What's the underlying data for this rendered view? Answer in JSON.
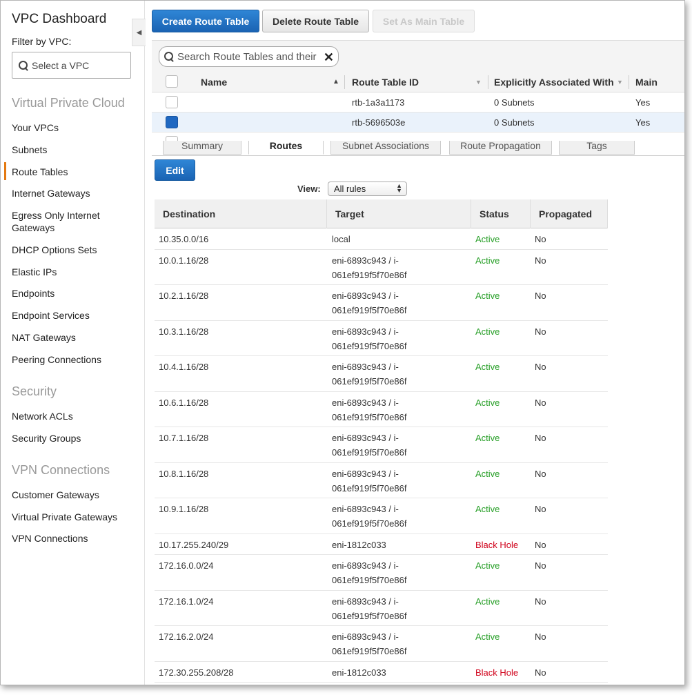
{
  "sidebar": {
    "title": "VPC Dashboard",
    "filter_label": "Filter by VPC:",
    "vpc_select_placeholder": "Select a VPC",
    "sections": [
      {
        "label": "Virtual Private Cloud",
        "items": [
          "Your VPCs",
          "Subnets",
          "Route Tables",
          "Internet Gateways",
          "Egress Only Internet Gateways",
          "DHCP Options Sets",
          "Elastic IPs",
          "Endpoints",
          "Endpoint Services",
          "NAT Gateways",
          "Peering Connections"
        ]
      },
      {
        "label": "Security",
        "items": [
          "Network ACLs",
          "Security Groups"
        ]
      },
      {
        "label": "VPN Connections",
        "items": [
          "Customer Gateways",
          "Virtual Private Gateways",
          "VPN Connections"
        ]
      }
    ],
    "active_item": "Route Tables"
  },
  "toolbar": {
    "create_label": "Create Route Table",
    "delete_label": "Delete Route Table",
    "set_main_label": "Set As Main Table"
  },
  "search": {
    "placeholder": "Search Route Tables and their"
  },
  "route_tables": {
    "columns": [
      "Name",
      "Route Table ID",
      "Explicitly Associated With",
      "Main"
    ],
    "rows": [
      {
        "name": "",
        "id": "rtb-1a3a1173",
        "assoc": "0 Subnets",
        "main": "Yes",
        "selected": false
      },
      {
        "name": "",
        "id": "rtb-5696503e",
        "assoc": "0 Subnets",
        "main": "Yes",
        "selected": true
      }
    ]
  },
  "tabs": [
    "Summary",
    "Routes",
    "Subnet Associations",
    "Route Propagation",
    "Tags"
  ],
  "active_tab": "Routes",
  "routes": {
    "edit_label": "Edit",
    "view_label": "View:",
    "view_value": "All rules",
    "columns": [
      "Destination",
      "Target",
      "Status",
      "Propagated"
    ],
    "rows": [
      {
        "dest": "10.35.0.0/16",
        "target": [
          "local"
        ],
        "status": "Active",
        "prop": "No"
      },
      {
        "dest": "10.0.1.16/28",
        "target": [
          "eni-6893c943 / i-",
          "061ef919f5f70e86f"
        ],
        "status": "Active",
        "prop": "No"
      },
      {
        "dest": "10.2.1.16/28",
        "target": [
          "eni-6893c943 / i-",
          "061ef919f5f70e86f"
        ],
        "status": "Active",
        "prop": "No"
      },
      {
        "dest": "10.3.1.16/28",
        "target": [
          "eni-6893c943 / i-",
          "061ef919f5f70e86f"
        ],
        "status": "Active",
        "prop": "No"
      },
      {
        "dest": "10.4.1.16/28",
        "target": [
          "eni-6893c943 / i-",
          "061ef919f5f70e86f"
        ],
        "status": "Active",
        "prop": "No"
      },
      {
        "dest": "10.6.1.16/28",
        "target": [
          "eni-6893c943 / i-",
          "061ef919f5f70e86f"
        ],
        "status": "Active",
        "prop": "No"
      },
      {
        "dest": "10.7.1.16/28",
        "target": [
          "eni-6893c943 / i-",
          "061ef919f5f70e86f"
        ],
        "status": "Active",
        "prop": "No"
      },
      {
        "dest": "10.8.1.16/28",
        "target": [
          "eni-6893c943 / i-",
          "061ef919f5f70e86f"
        ],
        "status": "Active",
        "prop": "No"
      },
      {
        "dest": "10.9.1.16/28",
        "target": [
          "eni-6893c943 / i-",
          "061ef919f5f70e86f"
        ],
        "status": "Active",
        "prop": "No"
      },
      {
        "dest": "10.17.255.240/29",
        "target": [
          "eni-1812c033"
        ],
        "status": "Black Hole",
        "prop": "No"
      },
      {
        "dest": "172.16.0.0/24",
        "target": [
          "eni-6893c943 / i-",
          "061ef919f5f70e86f"
        ],
        "status": "Active",
        "prop": "No"
      },
      {
        "dest": "172.16.1.0/24",
        "target": [
          "eni-6893c943 / i-",
          "061ef919f5f70e86f"
        ],
        "status": "Active",
        "prop": "No"
      },
      {
        "dest": "172.16.2.0/24",
        "target": [
          "eni-6893c943 / i-",
          "061ef919f5f70e86f"
        ],
        "status": "Active",
        "prop": "No"
      },
      {
        "dest": "172.30.255.208/28",
        "target": [
          "eni-1812c033"
        ],
        "status": "Black Hole",
        "prop": "No"
      }
    ]
  },
  "colors": {
    "primary_button": "#1a63b3",
    "active_status": "#2aa02a",
    "blackhole_status": "#d0021b",
    "nav_active_marker": "#e47911"
  }
}
